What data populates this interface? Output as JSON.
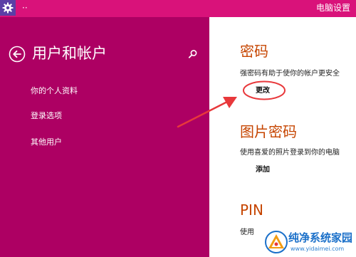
{
  "window": {
    "title": "电脑设置",
    "menu_glyph": "··",
    "icon": "gear-icon",
    "titlebar_color": "#d9127a",
    "icon_bg_color": "#5b3fa6"
  },
  "sidebar": {
    "title": "用户和帐户",
    "back_icon": "back-arrow-icon",
    "search_icon": "search-icon",
    "background": "#ad0063",
    "items": [
      {
        "label": "你的个人资料"
      },
      {
        "label": "登录选项"
      },
      {
        "label": "其他用户"
      }
    ]
  },
  "main": {
    "accent": "#c64500",
    "sections": [
      {
        "title": "密码",
        "desc": "强密码有助于使你的帐户更安全",
        "action": "更改"
      },
      {
        "title": "图片密码",
        "desc": "使用喜爱的照片登录到你的电脑",
        "action": "添加"
      },
      {
        "title": "PIN",
        "desc": "使用"
      }
    ]
  },
  "annotation": {
    "color": "#e8383b"
  },
  "watermark": {
    "text": "纯净系统家园",
    "url": "www.yidaimei.com"
  }
}
